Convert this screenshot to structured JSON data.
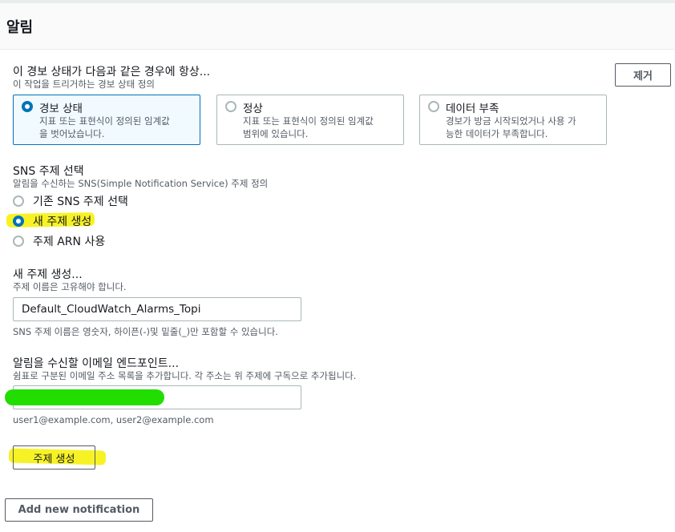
{
  "header": {
    "title": "알림"
  },
  "alarm_state": {
    "label": "이 경보 상태가 다음과 같은 경우에 항상...",
    "description": "이 작업을 트리거하는 경보 상태 정의",
    "remove_label": "제거",
    "options": [
      {
        "title": "경보 상태",
        "desc_line1": "지표 또는 표현식이 정의된 임계값",
        "desc_line2": "을 벗어났습니다.",
        "selected": true
      },
      {
        "title": "정상",
        "desc_line1": "지표 또는 표현식이 정의된 임계값",
        "desc_line2": "범위에 있습니다.",
        "selected": false
      },
      {
        "title": "데이터 부족",
        "desc_line1": "경보가 방금 시작되었거나 사용 가",
        "desc_line2": "능한 데이터가 부족합니다.",
        "selected": false
      }
    ]
  },
  "sns": {
    "label": "SNS 주제 선택",
    "description": "알림을 수신하는 SNS(Simple Notification Service) 주제 정의",
    "options": [
      {
        "label": "기존 SNS 주제 선택",
        "selected": false
      },
      {
        "label": "새 주제 생성",
        "selected": true
      },
      {
        "label": "주제 ARN 사용",
        "selected": false
      }
    ]
  },
  "new_topic": {
    "label": "새 주제 생성...",
    "description": "주제 이름은 고유해야 합니다.",
    "value": "Default_CloudWatch_Alarms_Topi",
    "hint": "SNS 주제 이름은 영숫자, 하이픈(-)및 밑줄(_)만 포함할 수 있습니다."
  },
  "email": {
    "label": "알림을 수신할 이메일 엔드포인트...",
    "description": "쉼표로 구분된 이메일 주소 목록을 추가합니다. 각 주소는 위 주제에 구독으로 추가됩니다.",
    "value": "",
    "hint": "user1@example.com, user2@example.com"
  },
  "buttons": {
    "create_topic": "주제 생성",
    "add_notification": "Add new notification"
  },
  "colors": {
    "accent": "#0073bb",
    "highlight_yellow": "#f6f000",
    "redaction_green": "#22dd00"
  }
}
